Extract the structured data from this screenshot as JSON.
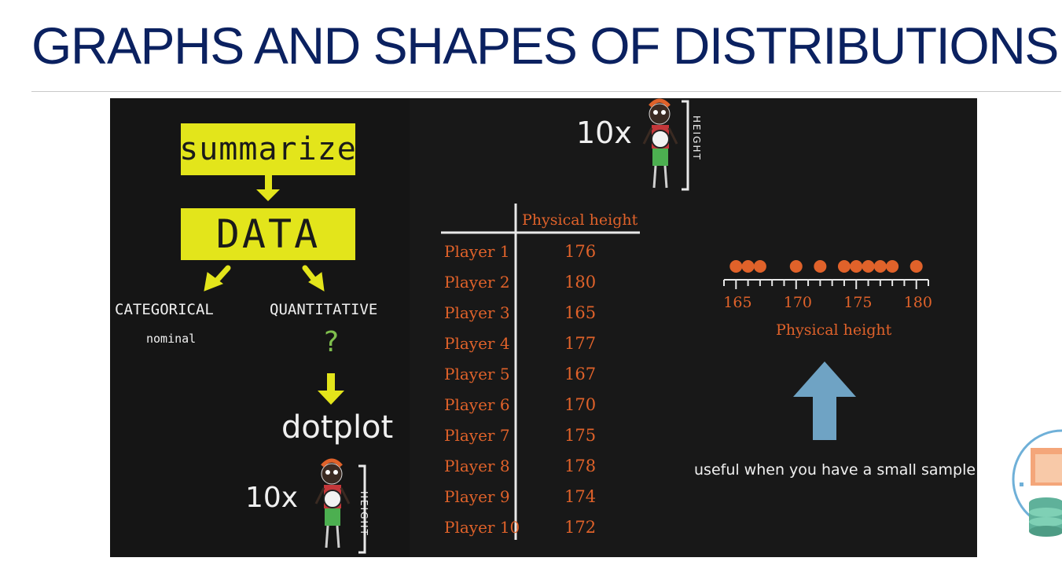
{
  "slide": {
    "title": "GRAPHS AND SHAPES OF DISTRIBUTIONS"
  },
  "flowchart": {
    "summarize_label": "summarize",
    "data_label": "DATA",
    "categorical_label": "CATEGORICAL",
    "categorical_sub": "nominal",
    "quantitative_label": "QUANTITATIVE",
    "question_mark": "?",
    "dotplot_label": "dotplot",
    "multiplier": "10x",
    "height_label": "HEIGHT"
  },
  "figure_top": {
    "multiplier": "10x",
    "height_label": "HEIGHT"
  },
  "table": {
    "header": "Physical height",
    "rows": [
      {
        "player": "Player 1",
        "height": "176"
      },
      {
        "player": "Player 2",
        "height": "180"
      },
      {
        "player": "Player 3",
        "height": "165"
      },
      {
        "player": "Player 4",
        "height": "177"
      },
      {
        "player": "Player 5",
        "height": "167"
      },
      {
        "player": "Player 6",
        "height": "170"
      },
      {
        "player": "Player 7",
        "height": "175"
      },
      {
        "player": "Player 8",
        "height": "178"
      },
      {
        "player": "Player 9",
        "height": "174"
      },
      {
        "player": "Player 10",
        "height": "172"
      }
    ]
  },
  "chart_data": {
    "type": "scatter",
    "xlabel": "Physical height",
    "xlim": [
      164,
      181
    ],
    "ticks": [
      "165",
      "170",
      "175",
      "180"
    ],
    "points": [
      165,
      166,
      167,
      170,
      172,
      174,
      175,
      176,
      177,
      178,
      180
    ],
    "color": "#e0622a"
  },
  "dotplot_note": "useful when you have a small sample",
  "colors": {
    "title": "#0b2160",
    "chalk_yellow": "#e3e51b",
    "chalk_orange": "#e0622a",
    "chalk_green": "#7fbf4d",
    "arrow_blue": "#6fa3c4"
  }
}
